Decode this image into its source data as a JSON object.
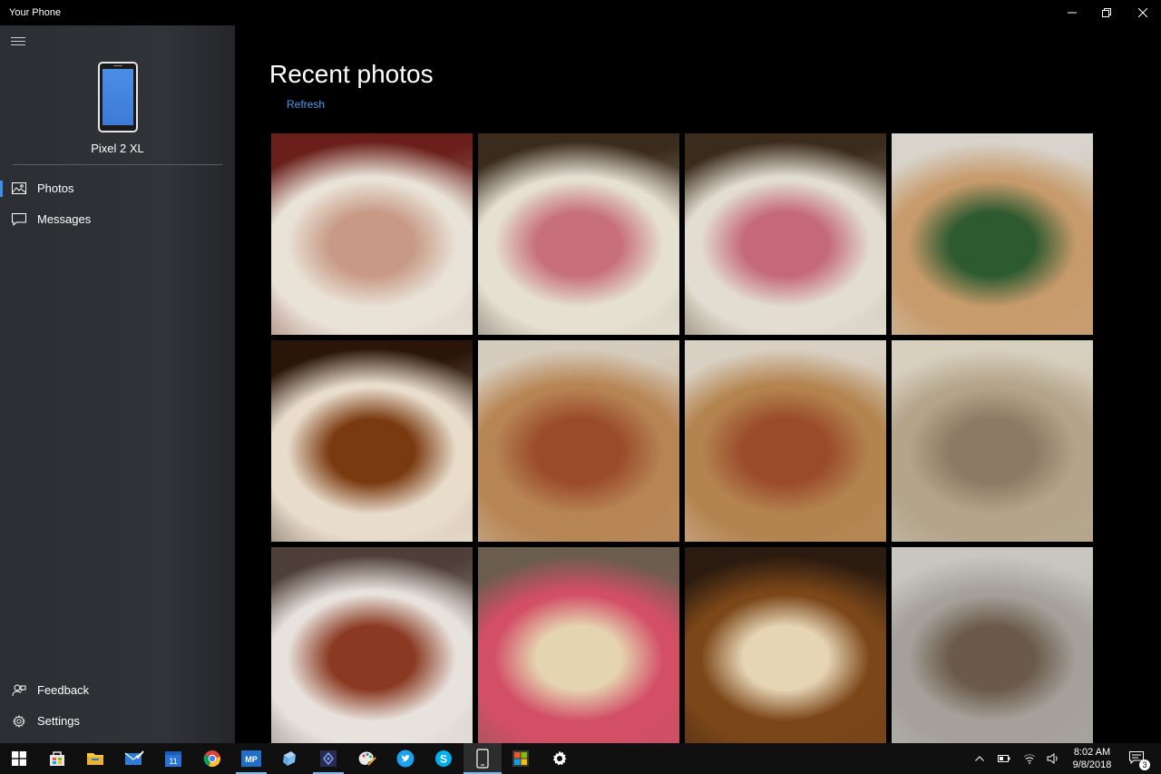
{
  "window": {
    "title": "Your Phone"
  },
  "sidebar": {
    "device_name": "Pixel 2 XL",
    "nav": [
      {
        "label": "Photos",
        "icon": "photos-icon",
        "active": true
      },
      {
        "label": "Messages",
        "icon": "messages-icon",
        "active": false
      }
    ],
    "bottom": [
      {
        "label": "Feedback",
        "icon": "feedback-icon"
      },
      {
        "label": "Settings",
        "icon": "gear-icon"
      }
    ]
  },
  "main": {
    "title": "Recent photos",
    "refresh_label": "Refresh",
    "photos": [
      {
        "subject": "sushi rolls with sprouts",
        "palette": [
          "#6a1f1b",
          "#e9e2d6",
          "#c89a86"
        ]
      },
      {
        "subject": "tuna sashimi with fried garnish",
        "palette": [
          "#3a2b1c",
          "#e5e0d2",
          "#c76f7d"
        ]
      },
      {
        "subject": "tuna sashimi with sauce dots",
        "palette": [
          "#3a2b1c",
          "#e2ddd0",
          "#c4687a"
        ]
      },
      {
        "subject": "crab salad with seaweed",
        "palette": [
          "#d8d4cc",
          "#c79b6c",
          "#2e5a30"
        ]
      },
      {
        "subject": "sliced fish in brown sauce",
        "palette": [
          "#2a1608",
          "#e8dccb",
          "#7a3a10"
        ]
      },
      {
        "subject": "rolled fish with crispy topping",
        "palette": [
          "#d6ccbd",
          "#b78554",
          "#9a4b2a"
        ]
      },
      {
        "subject": "rolled fish with crispy topping",
        "palette": [
          "#d9d0c3",
          "#b4844f",
          "#9a4b2a"
        ]
      },
      {
        "subject": "creamy soup",
        "palette": [
          "#d8d0bf",
          "#b3a48a",
          "#8c7b64"
        ]
      },
      {
        "subject": "bacon wrapped scallops",
        "palette": [
          "#4e4038",
          "#e8e2dc",
          "#8a3a22"
        ]
      },
      {
        "subject": "seared tuna with sesame",
        "palette": [
          "#6a5d4e",
          "#d24f66",
          "#e5d4b0"
        ]
      },
      {
        "subject": "glazed fried chicken",
        "palette": [
          "#2a1a0f",
          "#7b4618",
          "#e6d5b5"
        ]
      },
      {
        "subject": "oysters on ice",
        "palette": [
          "#c9c6c0",
          "#a5a19a",
          "#6b5a4a"
        ]
      }
    ]
  },
  "taskbar": {
    "apps": [
      {
        "name": "start-button",
        "icon": "windows-icon"
      },
      {
        "name": "store",
        "icon": "store-icon"
      },
      {
        "name": "file-explorer",
        "icon": "folder-icon"
      },
      {
        "name": "mail",
        "icon": "mail-icon"
      },
      {
        "name": "calendar",
        "icon": "calendar-icon",
        "text": "11"
      },
      {
        "name": "chrome",
        "icon": "chrome-icon"
      },
      {
        "name": "mp",
        "icon": "mp-icon",
        "text": "MP"
      },
      {
        "name": "app-cube",
        "icon": "cube-icon"
      },
      {
        "name": "app-visual",
        "icon": "diamond-icon"
      },
      {
        "name": "paint",
        "icon": "paint-icon"
      },
      {
        "name": "twitter",
        "icon": "twitter-icon"
      },
      {
        "name": "skype",
        "icon": "skype-icon"
      },
      {
        "name": "your-phone",
        "icon": "phone-icon"
      },
      {
        "name": "microsoft-store-2",
        "icon": "ms-logo-icon"
      },
      {
        "name": "settings",
        "icon": "gear-icon"
      }
    ],
    "time": "8:02 AM",
    "date": "9/8/2018",
    "notification_count": "3"
  },
  "colors": {
    "accent": "#3b8eea",
    "link": "#4a9cf0",
    "sidebar_bg": "#2e3136",
    "window_bg": "#000000"
  }
}
